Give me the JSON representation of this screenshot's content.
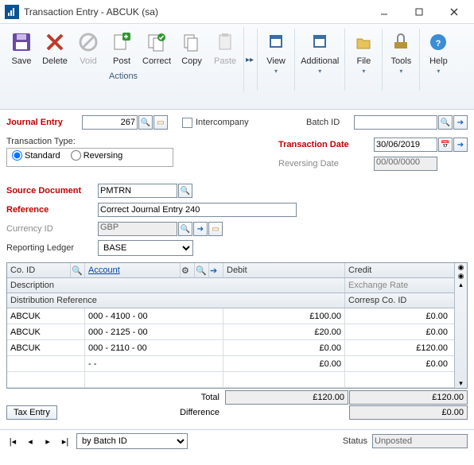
{
  "window": {
    "title": "Transaction Entry  -  ABCUK (sa)"
  },
  "ribbon": {
    "actions_label": "Actions",
    "buttons": {
      "save": "Save",
      "delete": "Delete",
      "void": "Void",
      "post": "Post",
      "correct": "Correct",
      "copy": "Copy",
      "paste": "Paste",
      "view": "View",
      "additional": "Additional",
      "file": "File",
      "tools": "Tools",
      "help": "Help"
    }
  },
  "form": {
    "journal_entry_label": "Journal Entry",
    "journal_entry_value": "267",
    "intercompany_label": "Intercompany",
    "batch_id_label": "Batch ID",
    "batch_id_value": "",
    "trx_type_label": "Transaction Type:",
    "standard": "Standard",
    "reversing": "Reversing",
    "trx_date_label": "Transaction Date",
    "trx_date_value": "30/06/2019",
    "rev_date_label": "Reversing Date",
    "rev_date_value": "00/00/0000",
    "src_doc_label": "Source Document",
    "src_doc_value": "PMTRN",
    "reference_label": "Reference",
    "reference_value": "Correct Journal Entry 240",
    "currency_label": "Currency ID",
    "currency_value": "GBP",
    "ledger_label": "Reporting Ledger",
    "ledger_value": "BASE"
  },
  "grid": {
    "headers": {
      "coid": "Co. ID",
      "account": "Account",
      "debit": "Debit",
      "credit": "Credit",
      "description": "Description",
      "exchange": "Exchange Rate",
      "distref": "Distribution Reference",
      "corresp": "Corresp Co. ID"
    },
    "rows": [
      {
        "coid": "ABCUK",
        "account": "000 - 4100 - 00",
        "debit": "£100.00",
        "credit": "£0.00"
      },
      {
        "coid": "ABCUK",
        "account": "000 - 2125 - 00",
        "debit": "£20.00",
        "credit": "£0.00"
      },
      {
        "coid": "ABCUK",
        "account": "000 - 2110 - 00",
        "debit": "£0.00",
        "credit": "£120.00"
      },
      {
        "coid": "",
        "account": "        -                -",
        "debit": "£0.00",
        "credit": "£0.00"
      },
      {
        "coid": "",
        "account": "",
        "debit": "",
        "credit": ""
      }
    ],
    "totals": {
      "total_label": "Total",
      "total_debit": "£120.00",
      "total_credit": "£120.00",
      "diff_label": "Difference",
      "diff_credit": "£0.00"
    },
    "tax_entry": "Tax Entry"
  },
  "footer": {
    "sort_by": "by Batch ID",
    "status_label": "Status",
    "status_value": "Unposted"
  }
}
